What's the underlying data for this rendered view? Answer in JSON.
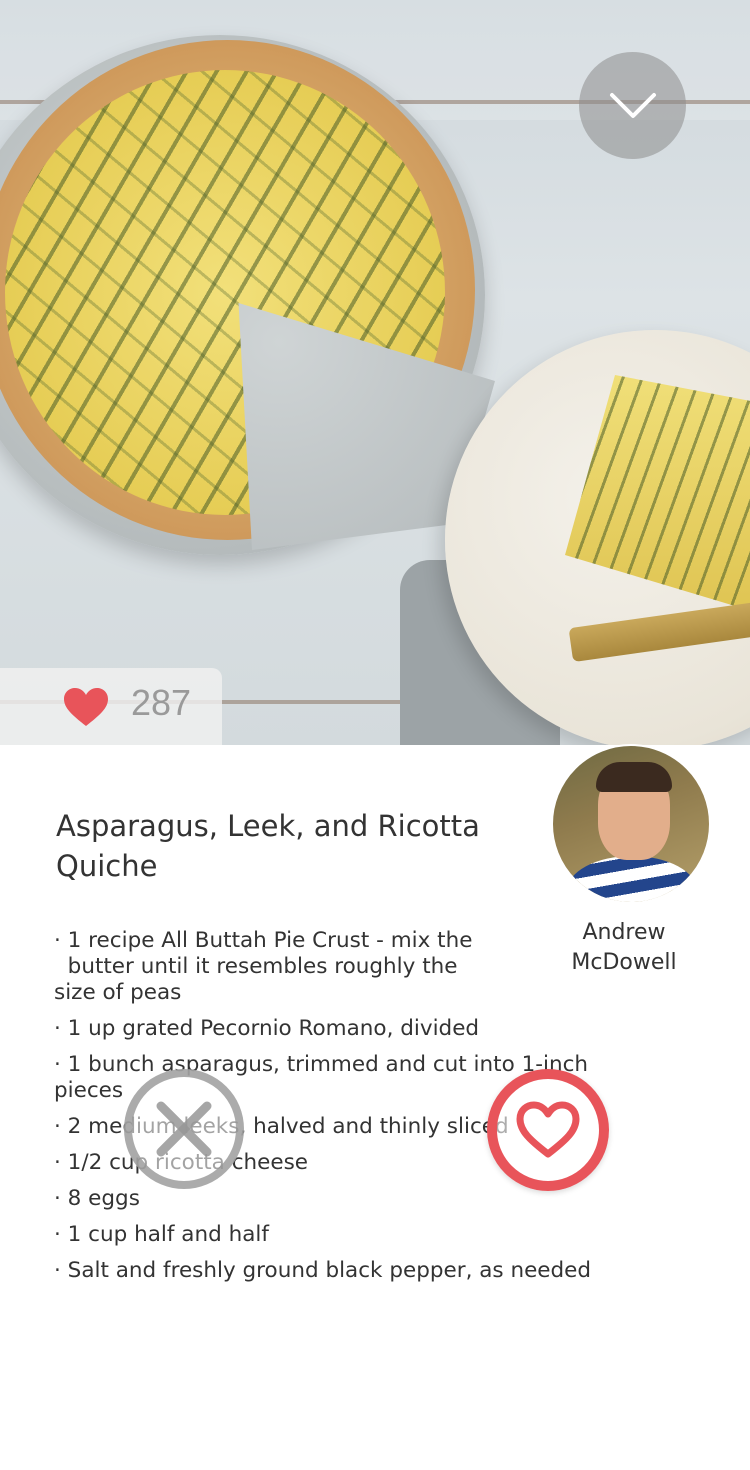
{
  "recipe": {
    "title": "Asparagus, Leek, and Ricotta Quiche",
    "likes": "287",
    "author": "Andrew McDowell",
    "ingredients": [
      "· 1 recipe All Buttah Pie Crust - mix the\n  butter until it resembles roughly the\nsize of peas",
      "· 1 up grated Pecornio Romano, divided",
      "· 1 bunch asparagus, trimmed and cut into 1-inch\npieces",
      "· 2 medium leeks, halved and thinly sliced",
      "· 1/2 cup ricotta cheese",
      "· 8 eggs",
      "· 1 cup half and half",
      "· Salt and freshly ground black pepper, as needed"
    ]
  },
  "colors": {
    "accent": "#e8545a",
    "dismiss": "#969696",
    "text": "#333333"
  },
  "icons": {
    "collapse": "chevron-down-icon",
    "likes": "heart-icon",
    "dismiss": "close-icon",
    "like": "heart-outline-icon"
  }
}
